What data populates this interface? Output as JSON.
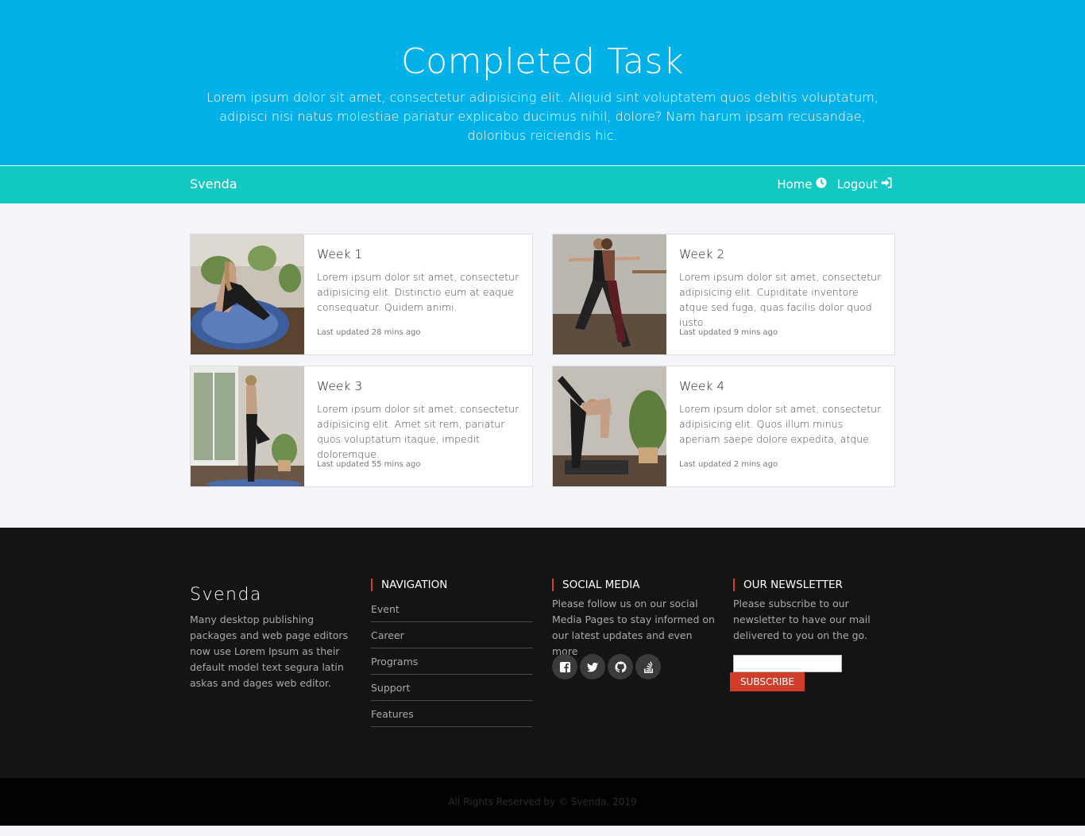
{
  "hero": {
    "title": "Completed Task",
    "subtitle": "Lorem ipsum dolor sit amet, consectetur adipisicing elit. Aliquid sint voluptatem quos debitis voluptatum, adipisci nisi natus molestiae pariatur explicabo ducimus nihil, dolore? Nam harum ipsam recusandae, doloribus reiciendis hic."
  },
  "navbar": {
    "brand": "Svenda",
    "links": [
      {
        "label": "Home",
        "icon": "clock-icon"
      },
      {
        "label": "Logout",
        "icon": "sign-in-icon"
      }
    ]
  },
  "cards": [
    {
      "title": "Week 1",
      "text": "Lorem ipsum dolor sit amet, consectetur adipisicing elit. Distinctio eum at eaque consequatur. Quidem animi.",
      "updated": "Last updated 28 mins ago"
    },
    {
      "title": "Week 2",
      "text": "Lorem ipsum dolor sit amet, consectetur adipisicing elit. Cupiditate inventore atque sed fuga, quas facilis dolor quod iusto.",
      "updated": "Last updated 9 mins ago"
    },
    {
      "title": "Week 3",
      "text": "Lorem ipsum dolor sit amet, consectetur adipisicing elit. Amet sit rem, pariatur quos voluptatum itaque, impedit doloremque.",
      "updated": "Last updated 55 mins ago"
    },
    {
      "title": "Week 4",
      "text": "Lorem ipsum dolor sit amet, consectetur adipisicing elit. Quos illum minus aperiam saepe dolore expedita, atque.",
      "updated": "Last updated 2 mins ago"
    }
  ],
  "footer": {
    "brand": "Svenda",
    "about": "Many desktop publishing packages and web page editors now use Lorem Ipsum as their default model text segura latin askas and dages web editor.",
    "navigation_title": "NAVIGATION",
    "navigation": [
      "Event",
      "Career",
      "Programs",
      "Support",
      "Features"
    ],
    "social_title": "SOCIAL MEDIA",
    "social_text": "Please follow us on our social Media Pages to stay informed on our latest updates and even more",
    "social_icons": [
      "facebook-icon",
      "twitter-icon",
      "github-icon",
      "stack-overflow-icon"
    ],
    "newsletter_title": "OUR NEWSLETTER",
    "newsletter_text": "Please subscribe to our newsletter to have our mail delivered to you on the go.",
    "newsletter_value": "",
    "subscribe_label": "SUBSCRIBE",
    "copyright": "All Rights Reserved by © Svenda. 2019"
  },
  "colors": {
    "hero": "#02b1e8",
    "navbar": "#12c8c2",
    "footer": "#141414",
    "accent": "#d23c2a"
  }
}
